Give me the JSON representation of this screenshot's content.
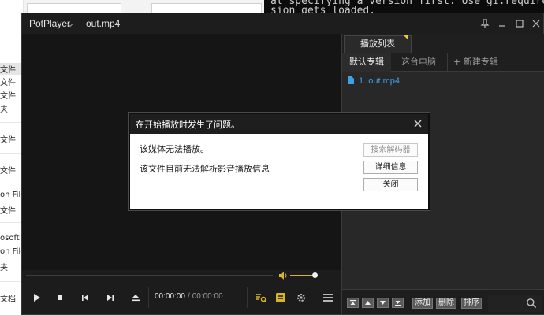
{
  "background": {
    "explorer_items": [
      "文件",
      "文件",
      "文件",
      "夹",
      "文件",
      "文件",
      "on File",
      "文件",
      "osoft",
      "on File",
      "夹",
      "文档"
    ],
    "terminal_lines": [
      "at specifying a version first. Use gi.require_ve",
      "sion gets loaded."
    ]
  },
  "player": {
    "app_name": "PotPlayer",
    "file_title": "out.mp4",
    "time_current": "00:00:00",
    "time_separator": "/",
    "time_total": "00:00:00",
    "volume_level": 0.85,
    "accent_color": "#d8b42a"
  },
  "playlist": {
    "header_tab": "播放列表",
    "tabs": [
      "默认专辑",
      "这台电脑",
      "+ 新建专辑"
    ],
    "items": [
      "1. out.mp4"
    ],
    "item_color": "#3f9fe8",
    "bottom_buttons": [
      "添加",
      "删除",
      "排序"
    ]
  },
  "dialog": {
    "title": "在开始播放时发生了问题。",
    "message_1": "该媒体无法播放。",
    "message_2": "该文件目前无法解析影音播放信息",
    "btn_search": "搜索解码器",
    "btn_details": "详细信息",
    "btn_close": "关闭"
  }
}
